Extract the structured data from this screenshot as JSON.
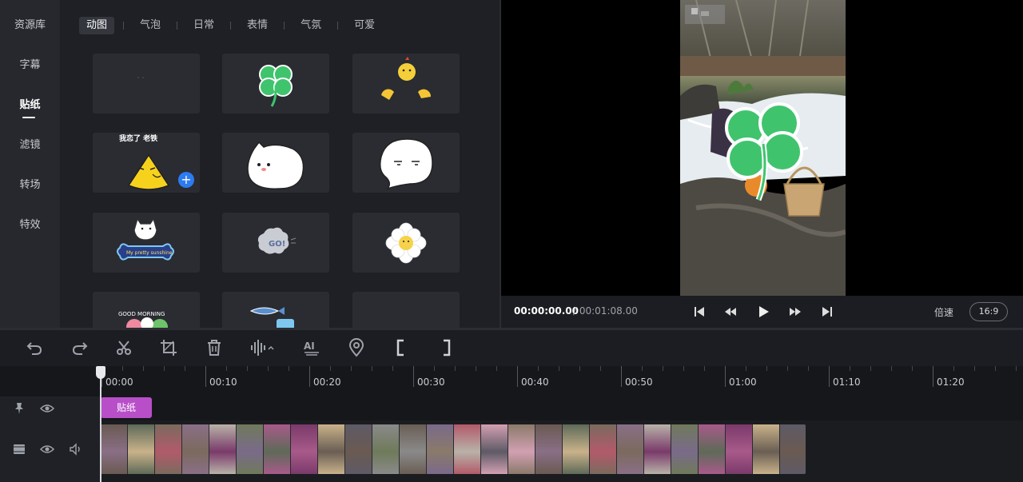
{
  "nav": {
    "items": [
      {
        "label": "资源库",
        "active": false
      },
      {
        "label": "字幕",
        "active": false
      },
      {
        "label": "贴纸",
        "active": true
      },
      {
        "label": "滤镜",
        "active": false
      },
      {
        "label": "转场",
        "active": false
      },
      {
        "label": "特效",
        "active": false
      }
    ]
  },
  "library": {
    "tabs": [
      "动图",
      "气泡",
      "日常",
      "表情",
      "气氛",
      "可爱"
    ],
    "active_tab": "动图",
    "tiles": [
      {
        "name": "blank",
        "text": ""
      },
      {
        "name": "four-leaf-clover",
        "text": ""
      },
      {
        "name": "chick-eggs",
        "text": ""
      },
      {
        "name": "yellow-rice-ball",
        "text": "我恋了 老铁"
      },
      {
        "name": "white-cat-bubble",
        "text": ""
      },
      {
        "name": "blank-face-bubble",
        "text": ""
      },
      {
        "name": "dog-bone",
        "text": "My pretty sunshine"
      },
      {
        "name": "go-cloud",
        "text": "GO!"
      },
      {
        "name": "daisy",
        "text": ""
      },
      {
        "name": "good-morning",
        "text": "GOOD MORNING"
      },
      {
        "name": "fish-teapot",
        "text": ""
      },
      {
        "name": "blank",
        "text": ""
      }
    ],
    "add_symbol": "+"
  },
  "player": {
    "current_time": "00:00:00.00",
    "total_time": "/ 00:01:08.00",
    "speed_label": "倍速",
    "ratio_label": "16:9"
  },
  "timeline": {
    "ticks": [
      "00:00",
      "00:10",
      "00:20",
      "00:30",
      "00:40",
      "00:50",
      "01:00",
      "01:10",
      "01:20"
    ],
    "sticker_clip_label": "贴纸"
  },
  "colors": {
    "accent_blue": "#2d7bf0",
    "sticker_clip": "#b84fc9",
    "clover_green": "#3fc46d"
  },
  "icons": [
    "undo-icon",
    "redo-icon",
    "scissors-icon",
    "crop-icon",
    "trash-icon",
    "audio-wave-icon",
    "ai-icon",
    "location-pin-icon",
    "bracket-left-icon",
    "bracket-right-icon",
    "skip-start-icon",
    "rewind-icon",
    "play-icon",
    "fast-forward-icon",
    "skip-end-icon",
    "pin-icon",
    "eye-icon",
    "film-icon",
    "volume-icon"
  ]
}
